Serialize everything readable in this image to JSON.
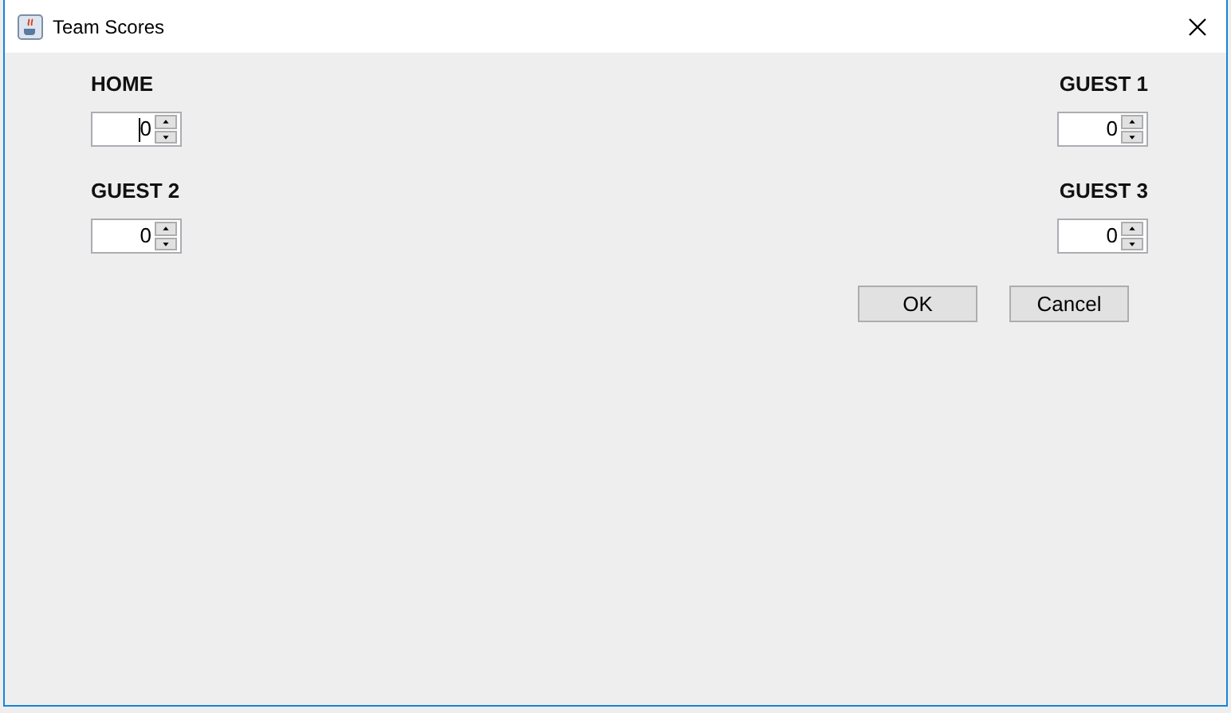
{
  "window": {
    "title": "Team  Scores"
  },
  "teams": [
    {
      "label": "HOME",
      "value": "0",
      "focused": true
    },
    {
      "label": "GUEST 1",
      "value": "0",
      "focused": false
    },
    {
      "label": "GUEST 2",
      "value": "0",
      "focused": false
    },
    {
      "label": "GUEST 3",
      "value": "0",
      "focused": false
    }
  ],
  "buttons": [
    "OK",
    "Cancel"
  ]
}
